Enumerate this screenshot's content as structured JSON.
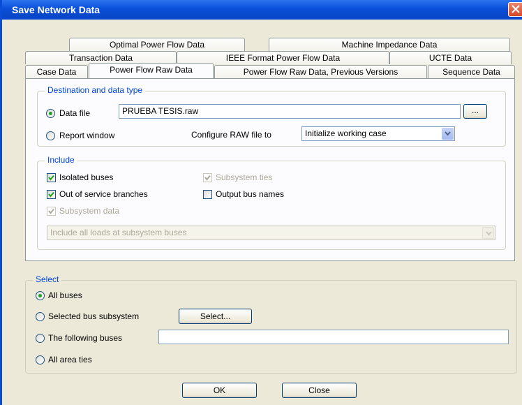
{
  "window": {
    "title": "Save Network Data"
  },
  "tabs": {
    "row1": [
      "Optimal Power Flow Data",
      "Machine Impedance Data"
    ],
    "row2": [
      "Transaction Data",
      "IEEE Format Power Flow Data",
      "UCTE Data"
    ],
    "row3": [
      "Case Data",
      "Power Flow Raw Data",
      "Power Flow Raw Data, Previous Versions",
      "Sequence Data"
    ],
    "active": "Power Flow Raw Data"
  },
  "destination": {
    "legend": "Destination and data type",
    "data_file_label": "Data file",
    "data_file_value": "PRUEBA TESIS.raw",
    "browse_label": "...",
    "report_window_label": "Report window",
    "configure_label": "Configure RAW file to",
    "configure_value": "Initialize working case",
    "selected": "data_file"
  },
  "include": {
    "legend": "Include",
    "isolated_buses": "Isolated buses",
    "out_of_service": "Out of service branches",
    "subsystem_data": "Subsystem data",
    "subsystem_ties": "Subsystem ties",
    "output_bus_names": "Output bus names",
    "loads_value": "Include all loads at subsystem buses"
  },
  "select": {
    "legend": "Select",
    "all_buses": "All buses",
    "selected_subsystem": "Selected bus subsystem",
    "select_button": "Select...",
    "following_buses": "The following buses",
    "following_buses_value": "",
    "all_area_ties": "All area ties",
    "selected": "all_buses"
  },
  "buttons": {
    "ok": "OK",
    "close": "Close"
  }
}
